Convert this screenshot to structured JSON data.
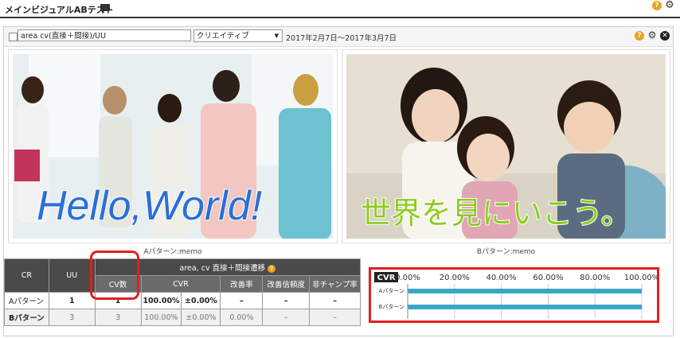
{
  "header": {
    "title": "メインビジュアルABテスト"
  },
  "toolbar": {
    "segment_value": "area cv(直接＋間接)/UU",
    "select_value": "クリエイティブ",
    "date_range": "2017年2月7日～2017年3月7日"
  },
  "images": {
    "a": {
      "overlay_text": "Hello,World!",
      "caption": "Aパターン:memo"
    },
    "b": {
      "overlay_text": "世界を見にいこう。",
      "caption": "Bパターン:memo"
    }
  },
  "table": {
    "headers": {
      "cr": "CR",
      "uu": "UU",
      "group": "area, cv 直接＋間接遷移",
      "cv": "CV数",
      "cvr": "CVR",
      "improve": "改善率",
      "confidence": "改善信頼度",
      "nonchamp": "非チャンプ率"
    },
    "rows": [
      {
        "label": "Aパターン",
        "uu": "1",
        "cv": "1",
        "cvr": "100.00%",
        "cvr_pm": "±0.00%",
        "improve": "–",
        "confidence": "–",
        "nonchamp": "–"
      },
      {
        "label": "Bパターン",
        "uu": "3",
        "cv": "3",
        "cvr": "100.00%",
        "cvr_pm": "±0.00%",
        "improve": "0.00%",
        "confidence": "–",
        "nonchamp": "–"
      }
    ]
  },
  "chart_data": {
    "type": "bar",
    "orientation": "horizontal",
    "title": "CVR",
    "categories": [
      "Aパターン",
      "Bパターン"
    ],
    "values": [
      100,
      100
    ],
    "xlim": [
      0,
      100
    ],
    "xticks": [
      "0.00%",
      "20.00%",
      "40.00%",
      "60.00%",
      "80.00%",
      "100.00%"
    ],
    "grid": true,
    "bar_color": "#3aa8c4"
  },
  "colors": {
    "accent_red": "#e02020",
    "help": "#f0a020"
  }
}
